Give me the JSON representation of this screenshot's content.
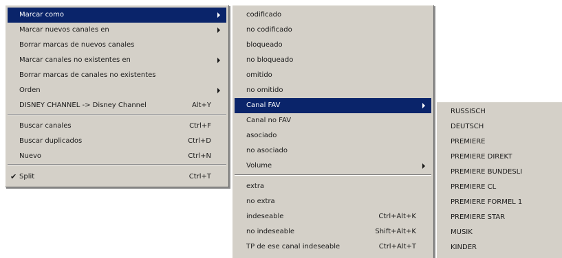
{
  "menu1": {
    "items": [
      {
        "label": "Marcar como",
        "submenu": true,
        "selected": true
      },
      {
        "label": "Marcar nuevos canales en",
        "submenu": true
      },
      {
        "label": "Borrar marcas de nuevos canales"
      },
      {
        "label": "Marcar canales no existentes en",
        "submenu": true
      },
      {
        "label": "Borrar marcas de canales no existentes"
      },
      {
        "label": "Orden",
        "submenu": true
      },
      {
        "label": "DISNEY CHANNEL -> Disney Channel",
        "shortcut": "Alt+Y"
      },
      {
        "label": "Buscar canales",
        "shortcut": "Ctrl+F"
      },
      {
        "label": "Buscar duplicados",
        "shortcut": "Ctrl+D"
      },
      {
        "label": "Nuevo",
        "shortcut": "Ctrl+N"
      },
      {
        "label": "Split",
        "shortcut": "Ctrl+T",
        "checked": true
      }
    ]
  },
  "menu2": {
    "items": [
      {
        "label": "codificado"
      },
      {
        "label": "no codificado"
      },
      {
        "label": "bloqueado"
      },
      {
        "label": "no bloqueado"
      },
      {
        "label": "omitido"
      },
      {
        "label": "no omitido"
      },
      {
        "label": "Canal FAV",
        "submenu": true,
        "selected": true
      },
      {
        "label": "Canal no FAV"
      },
      {
        "label": "asociado"
      },
      {
        "label": "no asociado"
      },
      {
        "label": "Volume",
        "submenu": true
      },
      {
        "label": "extra"
      },
      {
        "label": "no extra"
      },
      {
        "label": "indeseable",
        "shortcut": "Ctrl+Alt+K"
      },
      {
        "label": "no indeseable",
        "shortcut": "Shift+Alt+K"
      },
      {
        "label": "TP de ese canal indeseable",
        "shortcut": "Ctrl+Alt+T"
      }
    ]
  },
  "menu3": {
    "items": [
      {
        "label": "RUSSISCH"
      },
      {
        "label": "DEUTSCH"
      },
      {
        "label": "PREMIERE"
      },
      {
        "label": "PREMIERE DIREKT"
      },
      {
        "label": "PREMIERE BUNDESLI"
      },
      {
        "label": "PREMIERE CL"
      },
      {
        "label": "PREMIERE FORMEL 1"
      },
      {
        "label": "PREMIERE STAR"
      },
      {
        "label": "MUSIK"
      },
      {
        "label": "KINDER"
      }
    ]
  },
  "colors": {
    "menu_bg": "#d4d0c8",
    "highlight": "#0a246a",
    "highlight_text": "#ffffff"
  }
}
